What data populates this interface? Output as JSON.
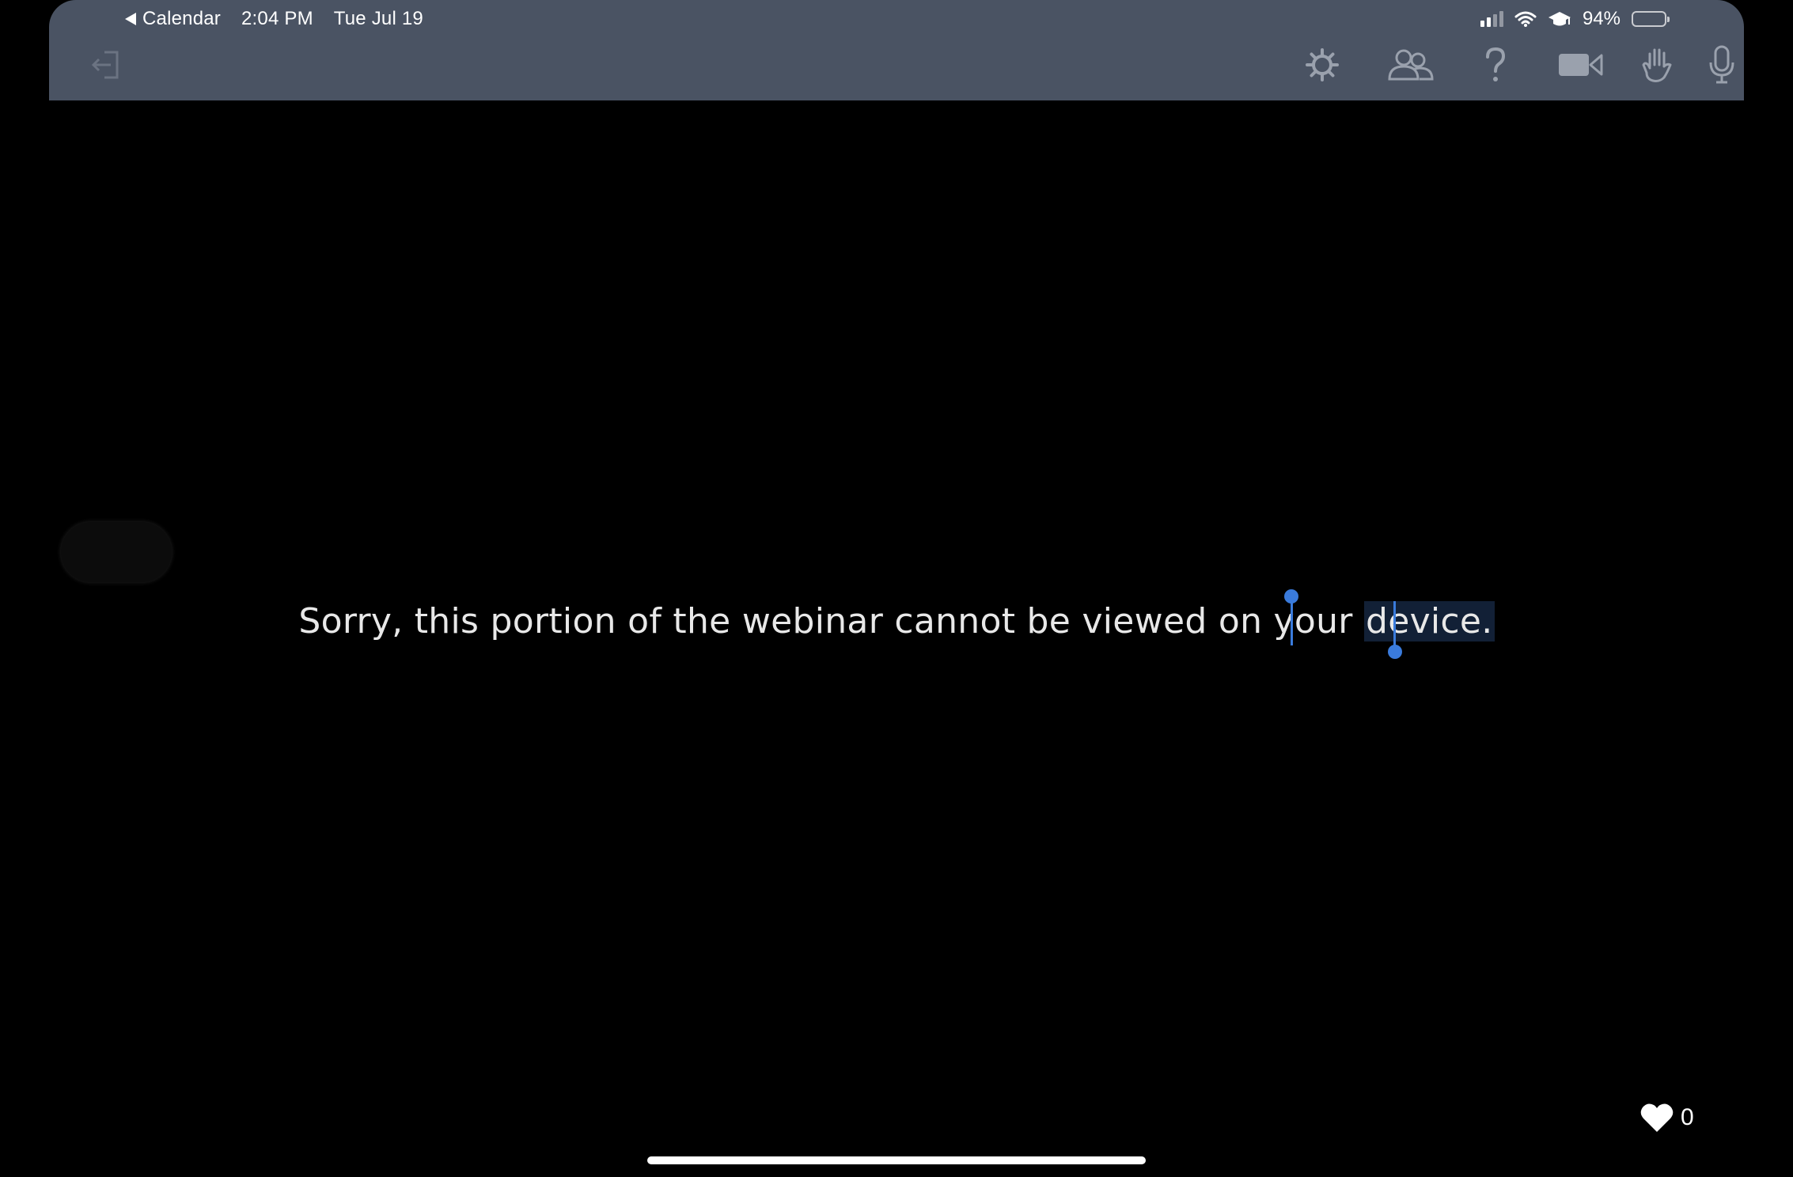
{
  "status_bar": {
    "back_app": "Calendar",
    "time": "2:04 PM",
    "date": "Tue Jul 19",
    "battery": "94%"
  },
  "toolbar": {
    "icons": [
      "exit-icon",
      "gear-icon",
      "participants-icon",
      "help-icon",
      "camera-icon",
      "raise-hand-icon",
      "microphone-icon"
    ],
    "colors": {
      "bar": "#4a5363",
      "icon": "#9aa1ad"
    }
  },
  "main": {
    "message_before": "Sorry, this portion of the webinar cannot be viewed on your ",
    "message_selected": "device.",
    "selection_color": "#3a7bdc"
  },
  "reactions": {
    "like_count": "0"
  }
}
